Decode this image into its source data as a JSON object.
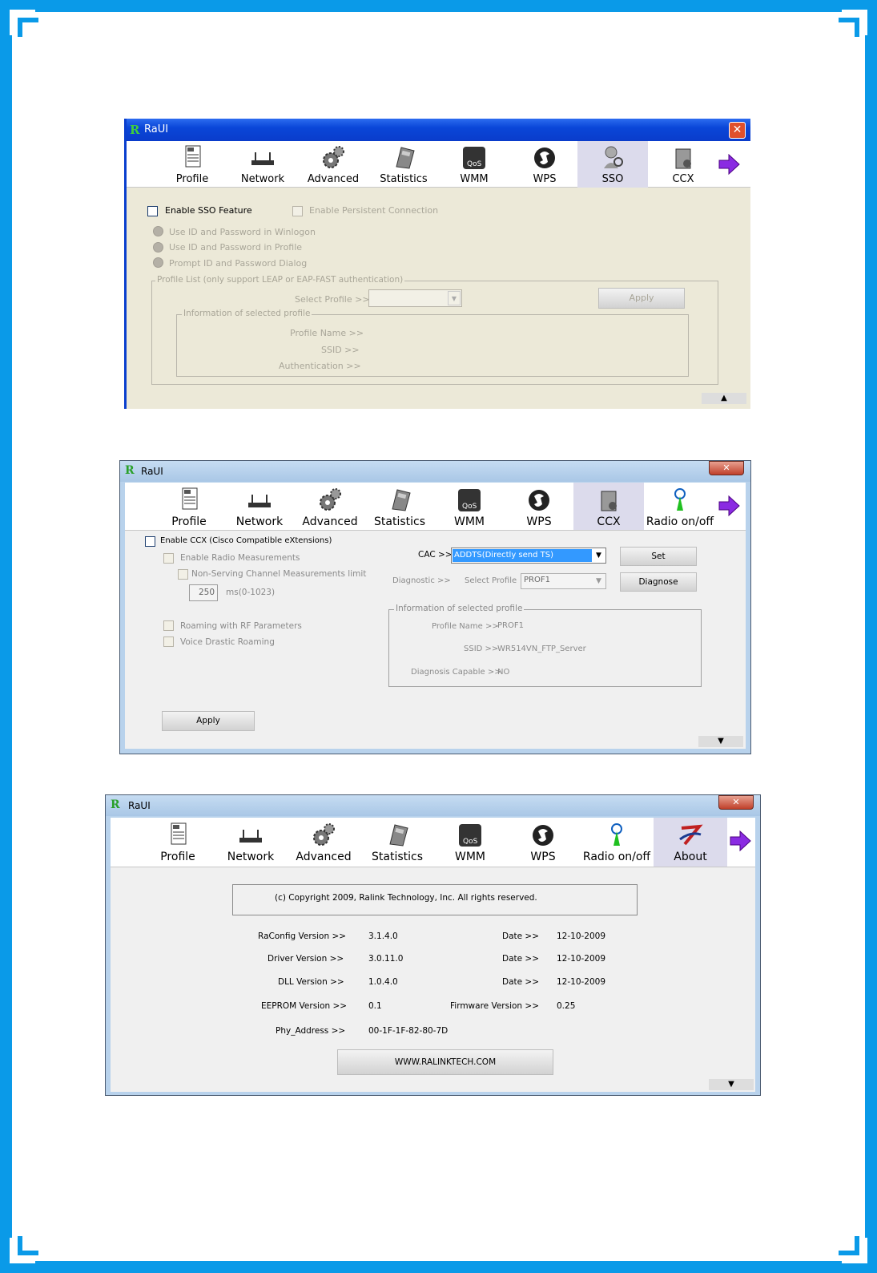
{
  "window_title": "RaUI",
  "toolbar_common": [
    {
      "label": "Profile",
      "icon": "profile-icon"
    },
    {
      "label": "Network",
      "icon": "network-icon"
    },
    {
      "label": "Advanced",
      "icon": "advanced-icon"
    },
    {
      "label": "Statistics",
      "icon": "statistics-icon"
    },
    {
      "label": "WMM",
      "icon": "wmm-qos-icon"
    },
    {
      "label": "WPS",
      "icon": "wps-icon"
    }
  ],
  "sso": {
    "tab_sso": "SSO",
    "tab_ccx": "CCX",
    "enable_sso": "Enable SSO Feature",
    "enable_persistent": "Enable Persistent Connection",
    "radio1": "Use ID and Password in Winlogon",
    "radio2": "Use ID and Password in Profile",
    "radio3": "Prompt ID and Password Dialog",
    "profile_list_legend": "Profile List (only support LEAP or EAP-FAST authentication)",
    "select_profile_label": "Select Profile >>",
    "apply": "Apply",
    "info_legend": "Information of selected profile",
    "profile_name_label": "Profile Name >>",
    "ssid_label": "SSID >>",
    "auth_label": "Authentication >>"
  },
  "ccx": {
    "tab_ccx": "CCX",
    "tab_radio": "Radio on/off",
    "enable_ccx": "Enable CCX (Cisco Compatible eXtensions)",
    "enable_radio_meas": "Enable Radio Measurements",
    "non_serving": "Non-Serving Channel Measurements limit",
    "limit_value": "250",
    "limit_unit": "ms(0-1023)",
    "roaming_rf": "Roaming with RF Parameters",
    "voice_roaming": "Voice Drastic Roaming",
    "cac_label": "CAC >>",
    "cac_value": "ADDTS(Directly send TS)",
    "set": "Set",
    "diagnostic_label": "Diagnostic >>",
    "select_profile_label": "Select Profile",
    "select_profile_value": "PROF1",
    "diagnose": "Diagnose",
    "info_legend": "Information of selected profile",
    "profile_name_label": "Profile Name >>",
    "profile_name_value": "PROF1",
    "ssid_label": "SSID >>",
    "ssid_value": "WR514VN_FTP_Server",
    "diag_cap_label": "Diagnosis Capable >>",
    "diag_cap_value": "NO",
    "apply": "Apply"
  },
  "about": {
    "tab_radio": "Radio on/off",
    "tab_about": "About",
    "copyright": "(c) Copyright 2009, Ralink Technology, Inc.  All rights reserved.",
    "raconfig_label": "RaConfig Version >>",
    "raconfig_value": "3.1.4.0",
    "driver_label": "Driver Version >>",
    "driver_value": "3.0.11.0",
    "dll_label": "DLL Version >>",
    "dll_value": "1.0.4.0",
    "eeprom_label": "EEPROM Version >>",
    "eeprom_value": "0.1",
    "phy_label": "Phy_Address >>",
    "phy_value": "00-1F-1F-82-80-7D",
    "date_label": "Date >>",
    "date1": "12-10-2009",
    "date2": "12-10-2009",
    "date3": "12-10-2009",
    "firmware_label": "Firmware Version >>",
    "firmware_value": "0.25",
    "website": "WWW.RALINKTECH.COM"
  }
}
